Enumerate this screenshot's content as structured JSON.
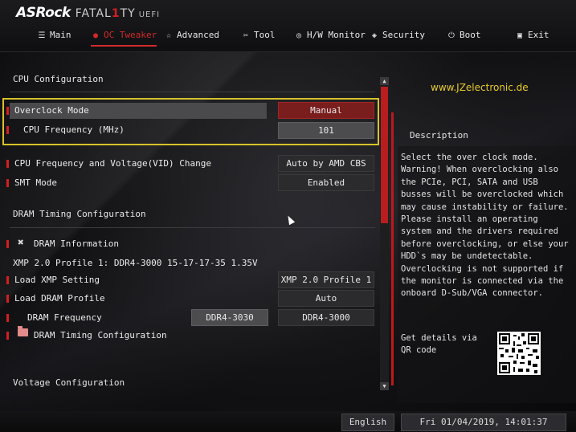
{
  "brand": {
    "name": "ASRock",
    "sub_pre": "FATAL",
    "sub_one": "1",
    "sub_post": "TY",
    "uefi": "UEFI"
  },
  "tabs": [
    {
      "label": "Main",
      "icon": "list-icon",
      "active": false
    },
    {
      "label": "OC Tweaker",
      "icon": "oc-tweaker-icon",
      "active": true
    },
    {
      "label": "Advanced",
      "icon": "star-icon",
      "active": false
    },
    {
      "label": "Tool",
      "icon": "tool-icon",
      "active": false
    },
    {
      "label": "H/W Monitor",
      "icon": "hw-monitor-icon",
      "active": false
    },
    {
      "label": "Security",
      "icon": "shield-icon",
      "active": false
    },
    {
      "label": "Boot",
      "icon": "power-icon",
      "active": false
    },
    {
      "label": "Exit",
      "icon": "exit-icon",
      "active": false
    }
  ],
  "cpu_section": "CPU Configuration",
  "overclock_mode": {
    "label": "Overclock Mode",
    "value": "Manual"
  },
  "cpu_frequency": {
    "label": "CPU Frequency (MHz)",
    "value": "101"
  },
  "cpu_freq_vid": {
    "label": "CPU Frequency and Voltage(VID) Change",
    "value": "Auto by AMD CBS"
  },
  "smt_mode": {
    "label": "SMT Mode",
    "value": "Enabled"
  },
  "dram_section": "DRAM Timing Configuration",
  "dram_info": {
    "label": "DRAM Information"
  },
  "xmp_line": "XMP 2.0 Profile 1: DDR4-3000 15-17-17-35 1.35V",
  "load_xmp": {
    "label": "Load XMP Setting",
    "value": "XMP 2.0 Profile 1"
  },
  "load_dram": {
    "label": "Load DRAM Profile",
    "value": "Auto"
  },
  "dram_freq": {
    "label": "DRAM Frequency",
    "current": "DDR4-3030",
    "value": "DDR4-3000"
  },
  "dram_timing": {
    "label": "DRAM Timing Configuration"
  },
  "voltage_section": "Voltage Configuration",
  "watermark": "www.JZelectronic.de",
  "description": {
    "title": "Description",
    "text": "Select the over clock mode.\nWarning! When overclocking also\nthe PCIe, PCI, SATA and USB\nbusses will be overclocked which\nmay cause instability or failure.\nPlease install an operating\nsystem and the drivers required\nbefore overclocking, or else your\nHDD`s may be undetectable.\nOverclocking is not supported if\nthe monitor is connected via the\nonboard D-Sub/VGA connector.",
    "qr_text": "Get details via QR code"
  },
  "footer": {
    "language": "English",
    "datetime": "Fri 01/04/2019, 14:01:37"
  },
  "colors": {
    "accent": "#d21f1f",
    "highlight": "#d7c22a"
  }
}
